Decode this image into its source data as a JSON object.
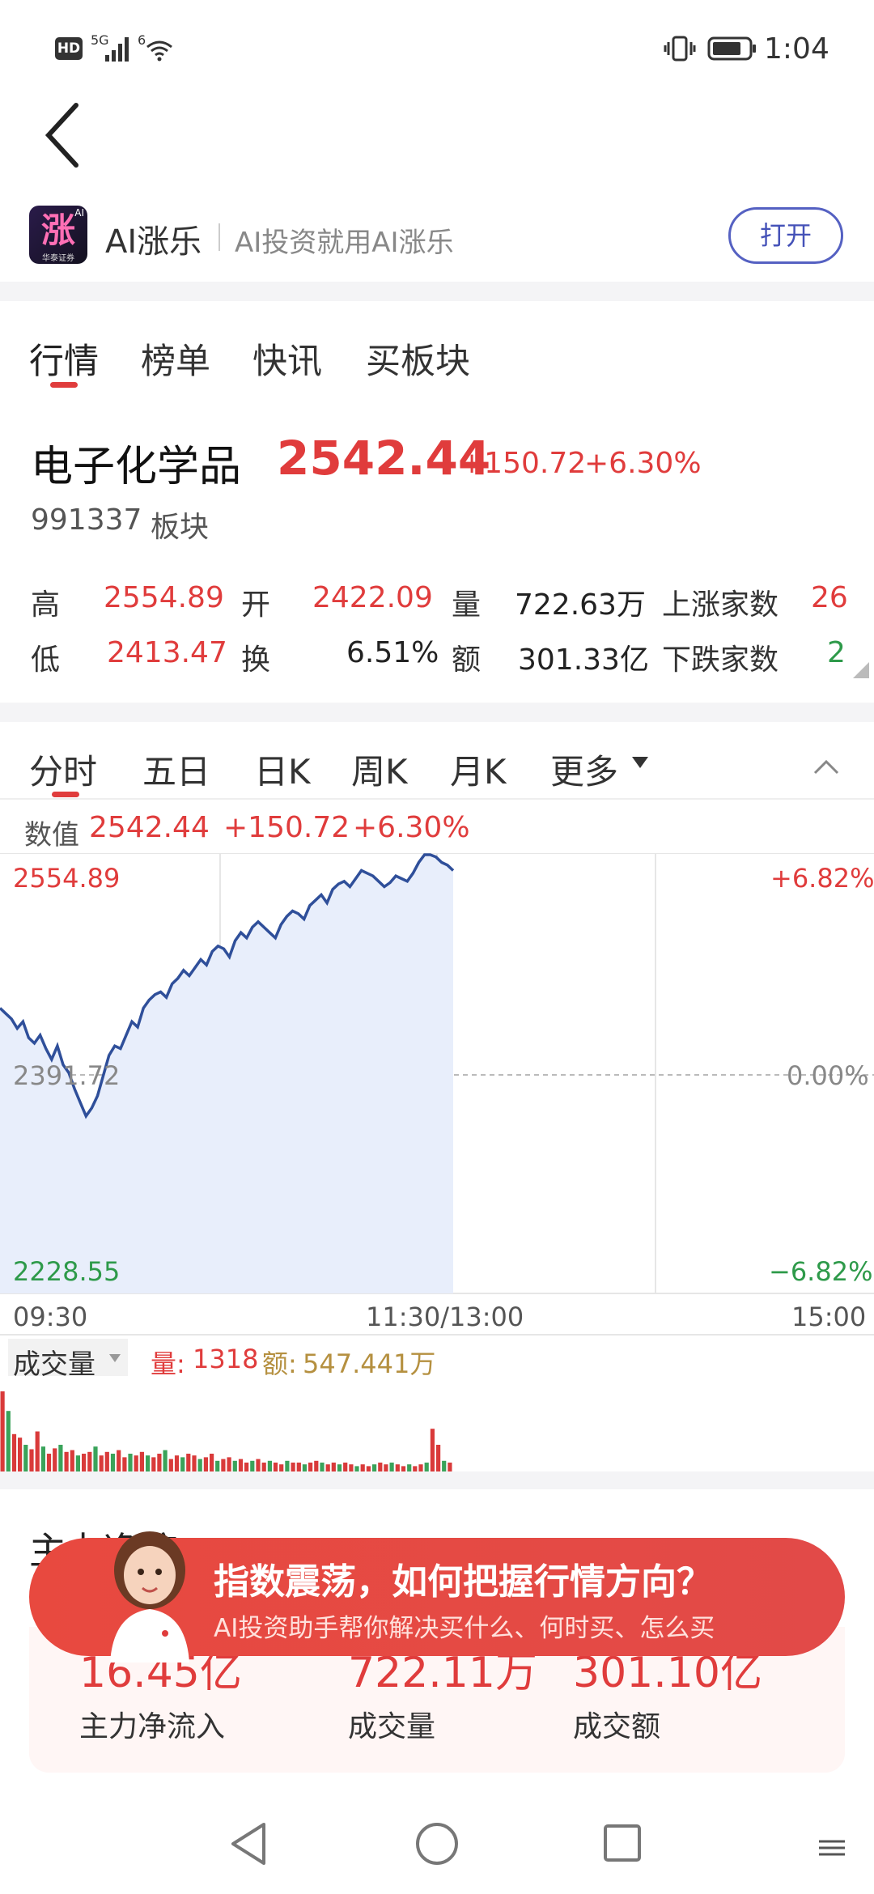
{
  "status_bar": {
    "hd": "HD",
    "net": "5G",
    "wifi_num": "6",
    "time": "1:04"
  },
  "app_banner": {
    "logo_text": "涨",
    "logo_sub": "华泰证券",
    "logo_badge": "AI",
    "app_name": "AI涨乐",
    "slogan": "AI投资就用AI涨乐",
    "open_label": "打开"
  },
  "tabs": [
    "行情",
    "榜单",
    "快讯",
    "买板块"
  ],
  "stock": {
    "name": "电子化学品",
    "price": "2542.44",
    "change": "+150.72",
    "change_pct": "+6.30%",
    "code": "991337",
    "type": "板块"
  },
  "stats": [
    [
      {
        "label": "高",
        "value": "2554.89"
      },
      {
        "label": "开",
        "value": "2422.09"
      },
      {
        "label": "量",
        "value": "722.63万"
      },
      {
        "label": "上涨家数",
        "value": "26"
      }
    ],
    [
      {
        "label": "低",
        "value": "2413.47"
      },
      {
        "label": "换",
        "value": "6.51%"
      },
      {
        "label": "额",
        "value": "301.33亿"
      },
      {
        "label": "下跌家数",
        "value": "2"
      }
    ]
  ],
  "chart_tabs": [
    "分时",
    "五日",
    "日K",
    "周K",
    "月K",
    "更多"
  ],
  "chart_info": {
    "label": "数值",
    "value": "2542.44",
    "change": "+150.72",
    "pct": "+6.30%"
  },
  "chart_data": {
    "type": "line",
    "y_max": 2554.89,
    "y_mid": 2391.72,
    "y_min": 2228.55,
    "pct_max": "+6.82%",
    "pct_mid": "0.00%",
    "pct_min": "−6.82%",
    "x_labels": [
      "09:30",
      "11:30/13:00",
      "15:00"
    ],
    "values": [
      2440,
      2436,
      2432,
      2425,
      2430,
      2418,
      2414,
      2420,
      2410,
      2402,
      2412,
      2398,
      2392,
      2380,
      2370,
      2360,
      2366,
      2375,
      2390,
      2405,
      2412,
      2410,
      2420,
      2430,
      2426,
      2440,
      2446,
      2450,
      2452,
      2448,
      2458,
      2462,
      2468,
      2464,
      2470,
      2476,
      2472,
      2482,
      2486,
      2484,
      2478,
      2490,
      2496,
      2492,
      2500,
      2504,
      2500,
      2496,
      2492,
      2502,
      2508,
      2512,
      2510,
      2506,
      2516,
      2520,
      2524,
      2518,
      2528,
      2532,
      2534,
      2530,
      2536,
      2542,
      2540,
      2538,
      2534,
      2530,
      2533,
      2538,
      2536,
      2534,
      2540,
      2548,
      2555,
      2560,
      2552,
      2548,
      2546,
      2542
    ]
  },
  "volume": {
    "label": "成交量",
    "vol_label": "量:",
    "vol": "1318",
    "amt_label": "额:",
    "amt": "547.441万"
  },
  "volume_bars": [
    0.9,
    0.68,
    0.42,
    0.38,
    0.3,
    0.25,
    0.45,
    0.28,
    0.2,
    0.26,
    0.3,
    0.22,
    0.24,
    0.18,
    0.2,
    0.22,
    0.28,
    0.18,
    0.22,
    0.2,
    0.24,
    0.16,
    0.2,
    0.18,
    0.22,
    0.18,
    0.16,
    0.2,
    0.24,
    0.14,
    0.18,
    0.16,
    0.2,
    0.18,
    0.14,
    0.16,
    0.2,
    0.12,
    0.14,
    0.16,
    0.12,
    0.14,
    0.1,
    0.12,
    0.14,
    0.1,
    0.12,
    0.1,
    0.08,
    0.12,
    0.1,
    0.1,
    0.08,
    0.1,
    0.12,
    0.1,
    0.08,
    0.1,
    0.08,
    0.1,
    0.08,
    0.06,
    0.08,
    0.06,
    0.08,
    0.1,
    0.08,
    0.1,
    0.08,
    0.06,
    0.08,
    0.06,
    0.08,
    0.1,
    0.48,
    0.3,
    0.12,
    0.1
  ],
  "ad_banner": {
    "title": "指数震荡，如何把握行情方向？",
    "subtitle": "AI投资助手帮你解决买什么、何时买、怎么买"
  },
  "bottom": {
    "hidden_title": "主力净流",
    "items": [
      {
        "value": "16.45亿",
        "label": "主力净流入"
      },
      {
        "value": "722.11万",
        "label": "成交量"
      },
      {
        "value": "301.10亿",
        "label": "成交额"
      }
    ]
  }
}
